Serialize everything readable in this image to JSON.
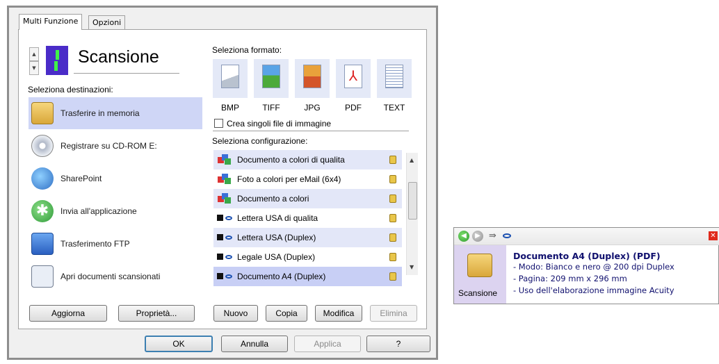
{
  "tabs": [
    "Multi Funzione",
    "Opzioni"
  ],
  "title": "Scansione",
  "destinations_label": "Seleziona destinazioni:",
  "destinations": [
    "Trasferire in memoria",
    "Registrare su CD-ROM  E:",
    "SharePoint",
    "Invia all'applicazione",
    "Trasferimento FTP",
    "Apri documenti scansionati"
  ],
  "format_label": "Seleziona formato:",
  "formats": [
    "BMP",
    "TIFF",
    "JPG",
    "PDF",
    "TEXT"
  ],
  "single_file_label": "Crea singoli file di immagine",
  "config_label": "Seleziona configurazione:",
  "configs": [
    "Documento a colori di qualita",
    "Foto a colori per eMail (6x4)",
    "Documento a colori",
    "Lettera USA di qualita",
    "Lettera USA (Duplex)",
    "Legale USA (Duplex)",
    "Documento A4 (Duplex)"
  ],
  "buttons": {
    "refresh": "Aggiorna",
    "properties": "Proprietà...",
    "new": "Nuovo",
    "copy": "Copia",
    "edit": "Modifica",
    "delete": "Elimina",
    "ok": "OK",
    "cancel": "Annulla",
    "apply": "Applica",
    "help": "?"
  },
  "widget": {
    "title": "Documento A4 (Duplex) (PDF)",
    "mode": "- Modo: Bianco e nero @ 200 dpi Duplex",
    "page": "- Pagina:  209 mm x 296 mm",
    "processing": "- Uso dell'elaborazione immagine Acuity",
    "label": "Scansione"
  }
}
